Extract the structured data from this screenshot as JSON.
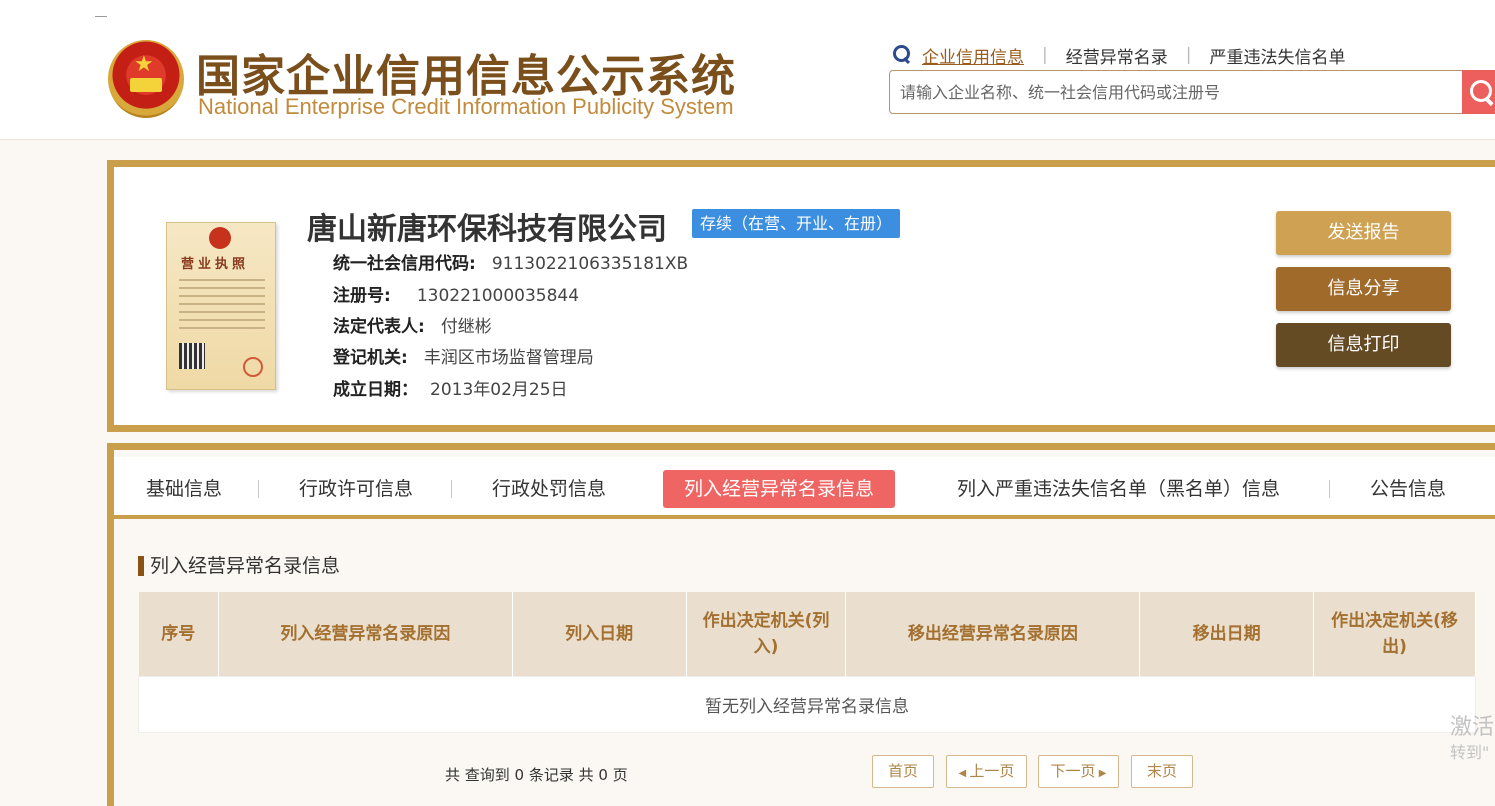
{
  "header": {
    "title_cn": "国家企业信用信息公示系统",
    "title_en": "National Enterprise Credit Information Publicity System",
    "nav": [
      "企业信用信息",
      "经营异常名录",
      "严重违法失信名单"
    ],
    "search_placeholder": "请输入企业名称、统一社会信用代码或注册号"
  },
  "company": {
    "name": "唐山新唐环保科技有限公司",
    "status": "存续（在营、开业、在册）",
    "fields": [
      {
        "label": "统一社会信用代码:",
        "value": "9113022106335181XB"
      },
      {
        "label": "注册号:",
        "value": "130221000035844"
      },
      {
        "label": "法定代表人:",
        "value": "付继彬"
      },
      {
        "label": "登记机关:",
        "value": "丰润区市场监督管理局"
      },
      {
        "label": "成立日期：",
        "value": "2013年02月25日"
      }
    ],
    "license_title": "营业执照"
  },
  "actions": {
    "report": "发送报告",
    "share": "信息分享",
    "print": "信息打印"
  },
  "tabs": [
    "基础信息",
    "行政许可信息",
    "行政处罚信息",
    "列入经营异常名录信息",
    "列入严重违法失信名单（黑名单）信息",
    "公告信息"
  ],
  "section": {
    "title": "列入经营异常名录信息",
    "columns": [
      "序号",
      "列入经营异常名录原因",
      "列入日期",
      "作出决定机关(列入)",
      "移出经营异常名录原因",
      "移出日期",
      "作出决定机关(移出)"
    ],
    "empty_text": "暂无列入经营异常名录信息"
  },
  "pager": {
    "summary": "共 查询到 0 条记录 共 0 页",
    "first": "首页",
    "prev": "上一页",
    "next": "下一页",
    "last": "末页"
  },
  "watermark": {
    "line1": "激活",
    "line2": "转到\""
  },
  "colors": {
    "brand_gold": "#c99f4c",
    "active_tab": "#ef6563",
    "status_blue": "#3c8ee0"
  }
}
